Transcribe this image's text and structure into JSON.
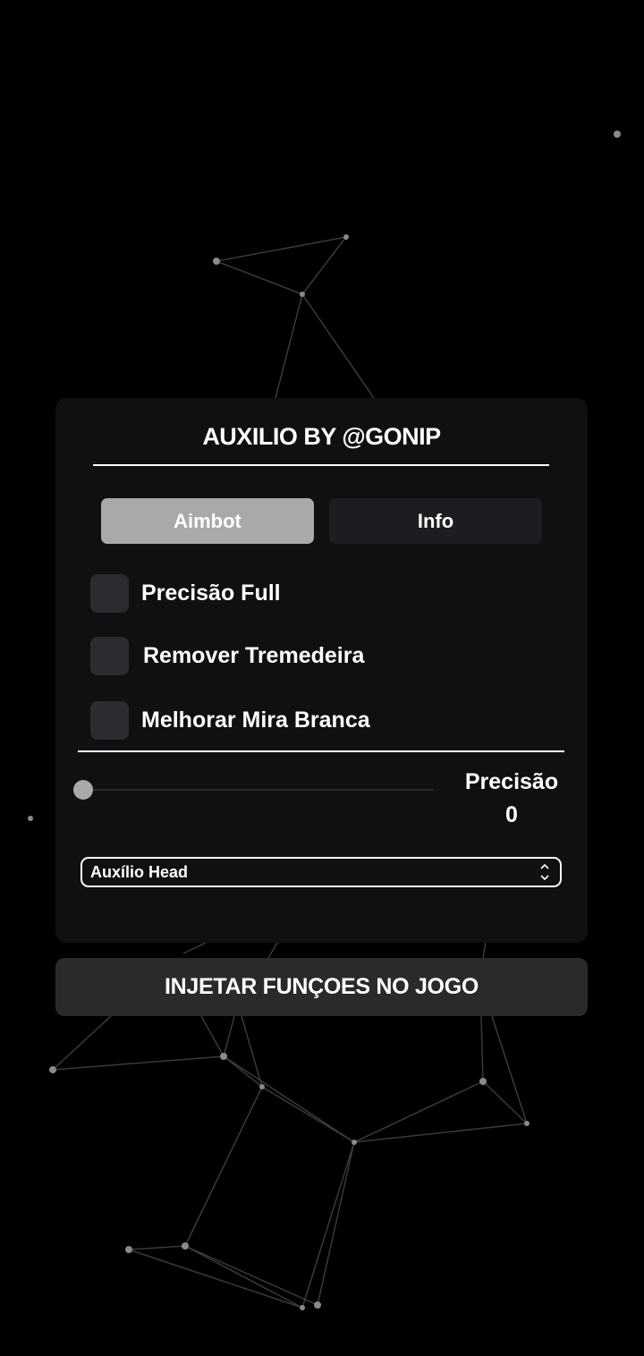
{
  "panel": {
    "title": "AUXILIO BY @GONIP",
    "tabs": [
      {
        "label": "Aimbot",
        "active": true
      },
      {
        "label": "Info",
        "active": false
      }
    ],
    "options": [
      {
        "label": "Precisão Full",
        "checked": false
      },
      {
        "label": "Remover Tremedeira",
        "checked": false
      },
      {
        "label": "Melhorar Mira Branca",
        "checked": false
      }
    ],
    "slider": {
      "label": "Precisão",
      "value": "0"
    },
    "select": {
      "value": "Auxílio Head"
    }
  },
  "inject_button": {
    "label": "INJETAR FUNÇOES NO JOGO"
  },
  "colors": {
    "background": "#000000",
    "panel": "#0f1012",
    "active_tab": "#a9a9a9",
    "inactive_tab": "#1c1d20",
    "checkbox": "#2b2c2f",
    "inject_button": "#2a2a2c",
    "text": "#ffffff"
  }
}
